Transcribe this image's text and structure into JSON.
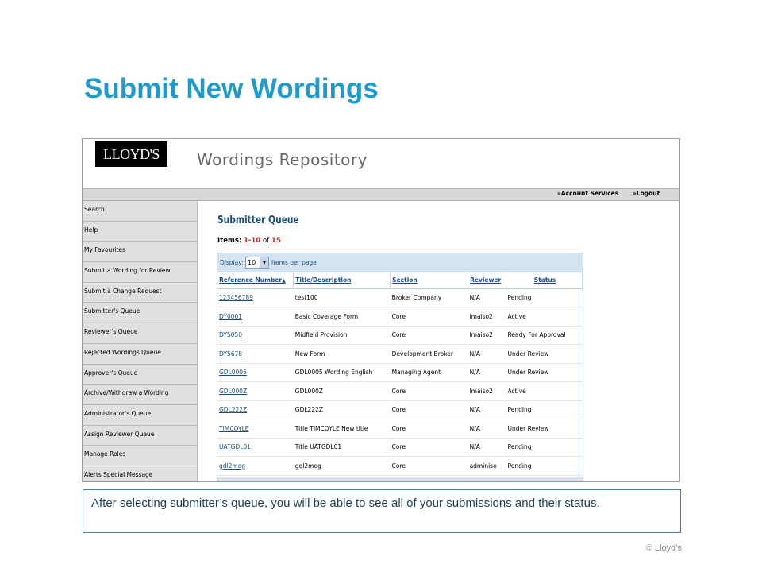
{
  "slide": {
    "title": "Submit New Wordings",
    "caption": "After selecting submitter’s queue, you will be able to see all of your submissions and their status.",
    "copyright": "© Lloyd’s"
  },
  "app": {
    "logo": "LLOYD'S",
    "title": "Wordings Repository",
    "topnav": {
      "account": "»Account Services",
      "logout": "»Logout"
    }
  },
  "sidebar": {
    "items": [
      {
        "label": "Search"
      },
      {
        "label": "Help"
      },
      {
        "label": "My Favourites"
      },
      {
        "label": "Submit a Wording for Review"
      },
      {
        "label": "Submit a Change Request"
      },
      {
        "label": "Submitter's Queue"
      },
      {
        "label": "Reviewer's Queue"
      },
      {
        "label": "Rejected Wordings Queue"
      },
      {
        "label": "Approver's Queue"
      },
      {
        "label": "Archive/Withdraw a Wording"
      },
      {
        "label": "Administrator's Queue"
      },
      {
        "label": "Assign Reviewer Queue"
      },
      {
        "label": "Manage Roles"
      },
      {
        "label": "Alerts Special Message"
      }
    ]
  },
  "queue": {
    "title": "Submitter Queue",
    "items_label": "Items:",
    "items_range": "1-10",
    "items_of": "of",
    "items_total": "15",
    "display_label": "Display:",
    "display_value": "10",
    "display_suffix": "items per page",
    "columns": {
      "ref": "Reference Number",
      "title": "Title/Description",
      "section": "Section",
      "reviewer": "Reviewer",
      "status": "Status"
    },
    "rows": [
      {
        "ref": "123456789",
        "title": "test100",
        "section": "Broker Company",
        "reviewer": "N/A",
        "status": "Pending"
      },
      {
        "ref": "DY0001",
        "title": "Basic Coverage Form",
        "section": "Core",
        "reviewer": "lmaiso2",
        "status": "Active"
      },
      {
        "ref": "DY5050",
        "title": "Midfield Provision",
        "section": "Core",
        "reviewer": "lmaiso2",
        "status": "Ready For Approval"
      },
      {
        "ref": "DY5678",
        "title": "New Form",
        "section": "Development Broker",
        "reviewer": "N/A",
        "status": "Under Review"
      },
      {
        "ref": "GDL0005",
        "title": "GDL0005 Wording English",
        "section": "Managing Agent",
        "reviewer": "N/A",
        "status": "Under Review"
      },
      {
        "ref": "GDL000Z",
        "title": "GDL000Z",
        "section": "Core",
        "reviewer": "lmaiso2",
        "status": "Active"
      },
      {
        "ref": "GDL222Z",
        "title": "GDL222Z",
        "section": "Core",
        "reviewer": "N/A",
        "status": "Pending"
      },
      {
        "ref": "TIMCOYLE",
        "title": "Title TIMCOYLE New title",
        "section": "Core",
        "reviewer": "N/A",
        "status": "Under Review"
      },
      {
        "ref": "UATGDL01",
        "title": "Title UATGDL01",
        "section": "Core",
        "reviewer": "N/A",
        "status": "Pending"
      },
      {
        "ref": "gdl2meg",
        "title": "gdl2meg",
        "section": "Core",
        "reviewer": "adminiso",
        "status": "Pending"
      }
    ]
  }
}
